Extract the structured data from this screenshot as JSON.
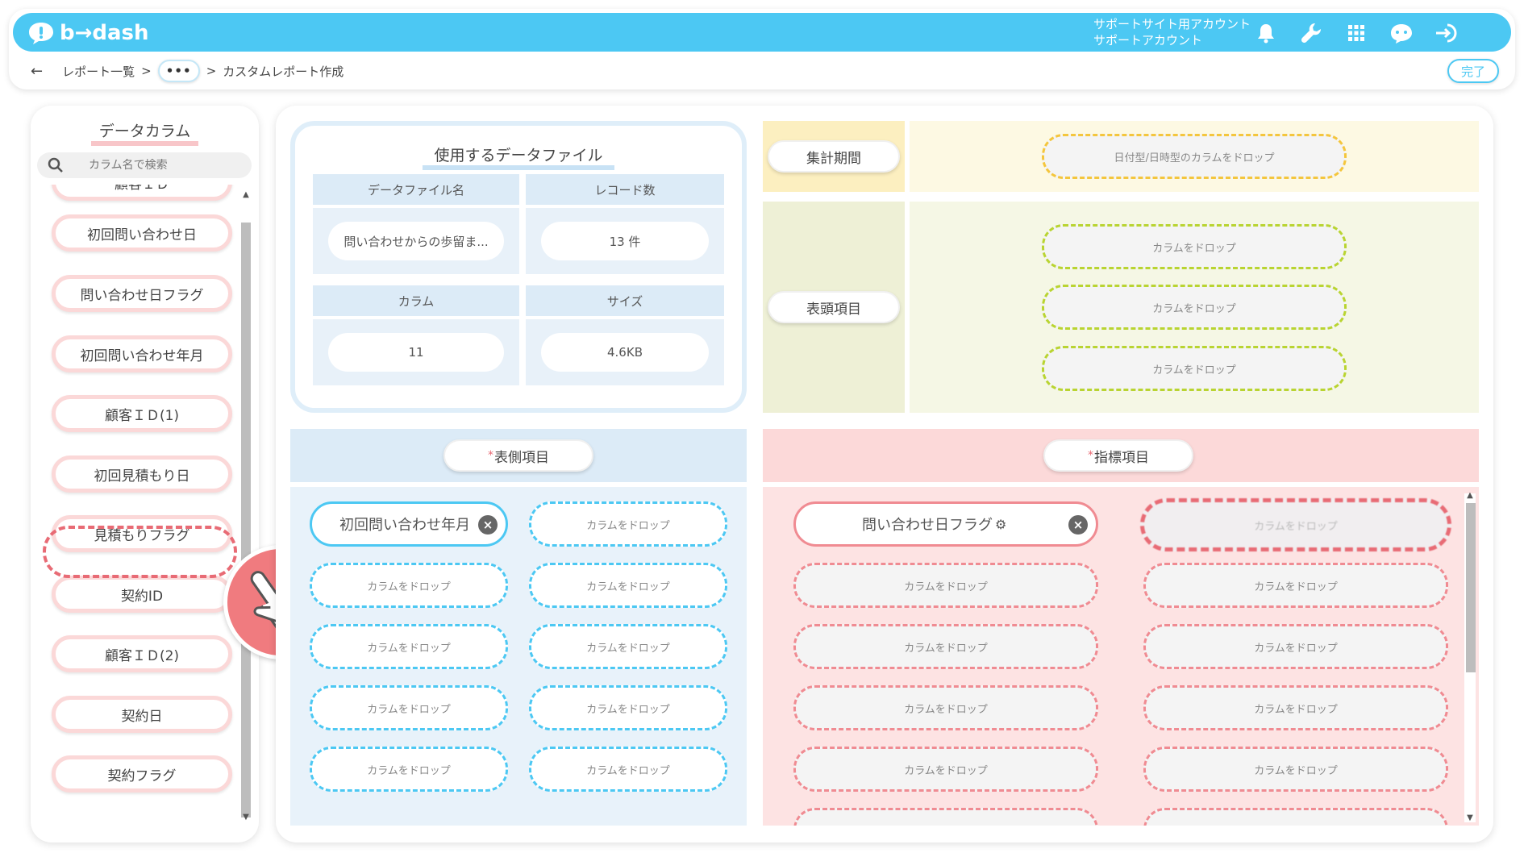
{
  "header": {
    "logo_text": "b→dash",
    "account_line1": "サポートサイト用アカウント",
    "account_line2": "サポートアカウント",
    "icons": [
      "bell-icon",
      "wrench-icon",
      "apps-grid-icon",
      "chat-bot-icon",
      "logout-icon"
    ],
    "accent_color": "#4cc8f3"
  },
  "breadcrumb": {
    "back": "←",
    "item1": "レポート一覧",
    "sep": ">",
    "ellipsis": "•••",
    "current": "カスタムレポート作成",
    "done_label": "完了"
  },
  "columns_panel": {
    "title": "データカラム",
    "search_placeholder": "カラム名で検索",
    "items": [
      "顧客ＩＤ",
      "初回問い合わせ日",
      "問い合わせ日フラグ",
      "初回問い合わせ年月",
      "顧客ＩＤ(1)",
      "初回見積もり日",
      "見積もりフラグ",
      "契約ID",
      "顧客ＩＤ(2)",
      "契約日",
      "契約フラグ"
    ]
  },
  "datafile": {
    "title": "使用するデータファイル",
    "name_label": "データファイル名",
    "name_value": "問い合わせからの歩留ま...",
    "records_label": "レコード数",
    "records_value": "13 件",
    "columns_label": "カラム",
    "columns_value": "11",
    "size_label": "サイズ",
    "size_value": "4.6KB"
  },
  "period": {
    "label": "集計期間",
    "drop_hint": "日付型/日時型のカラムをドロップ"
  },
  "header_items": {
    "label": "表頭項目",
    "drop_hint": "カラムをドロップ"
  },
  "side_items": {
    "required_mark": "*",
    "label": "表側項目",
    "filled_value": "初回問い合わせ年月",
    "drop_hint": "カラムをドロップ"
  },
  "index_items": {
    "required_mark": "*",
    "label": "指標項目",
    "filled_value": "問い合わせ日フラグ",
    "drop_hint": "カラムをドロップ",
    "blurred_hint": "カラムをドロップ"
  }
}
